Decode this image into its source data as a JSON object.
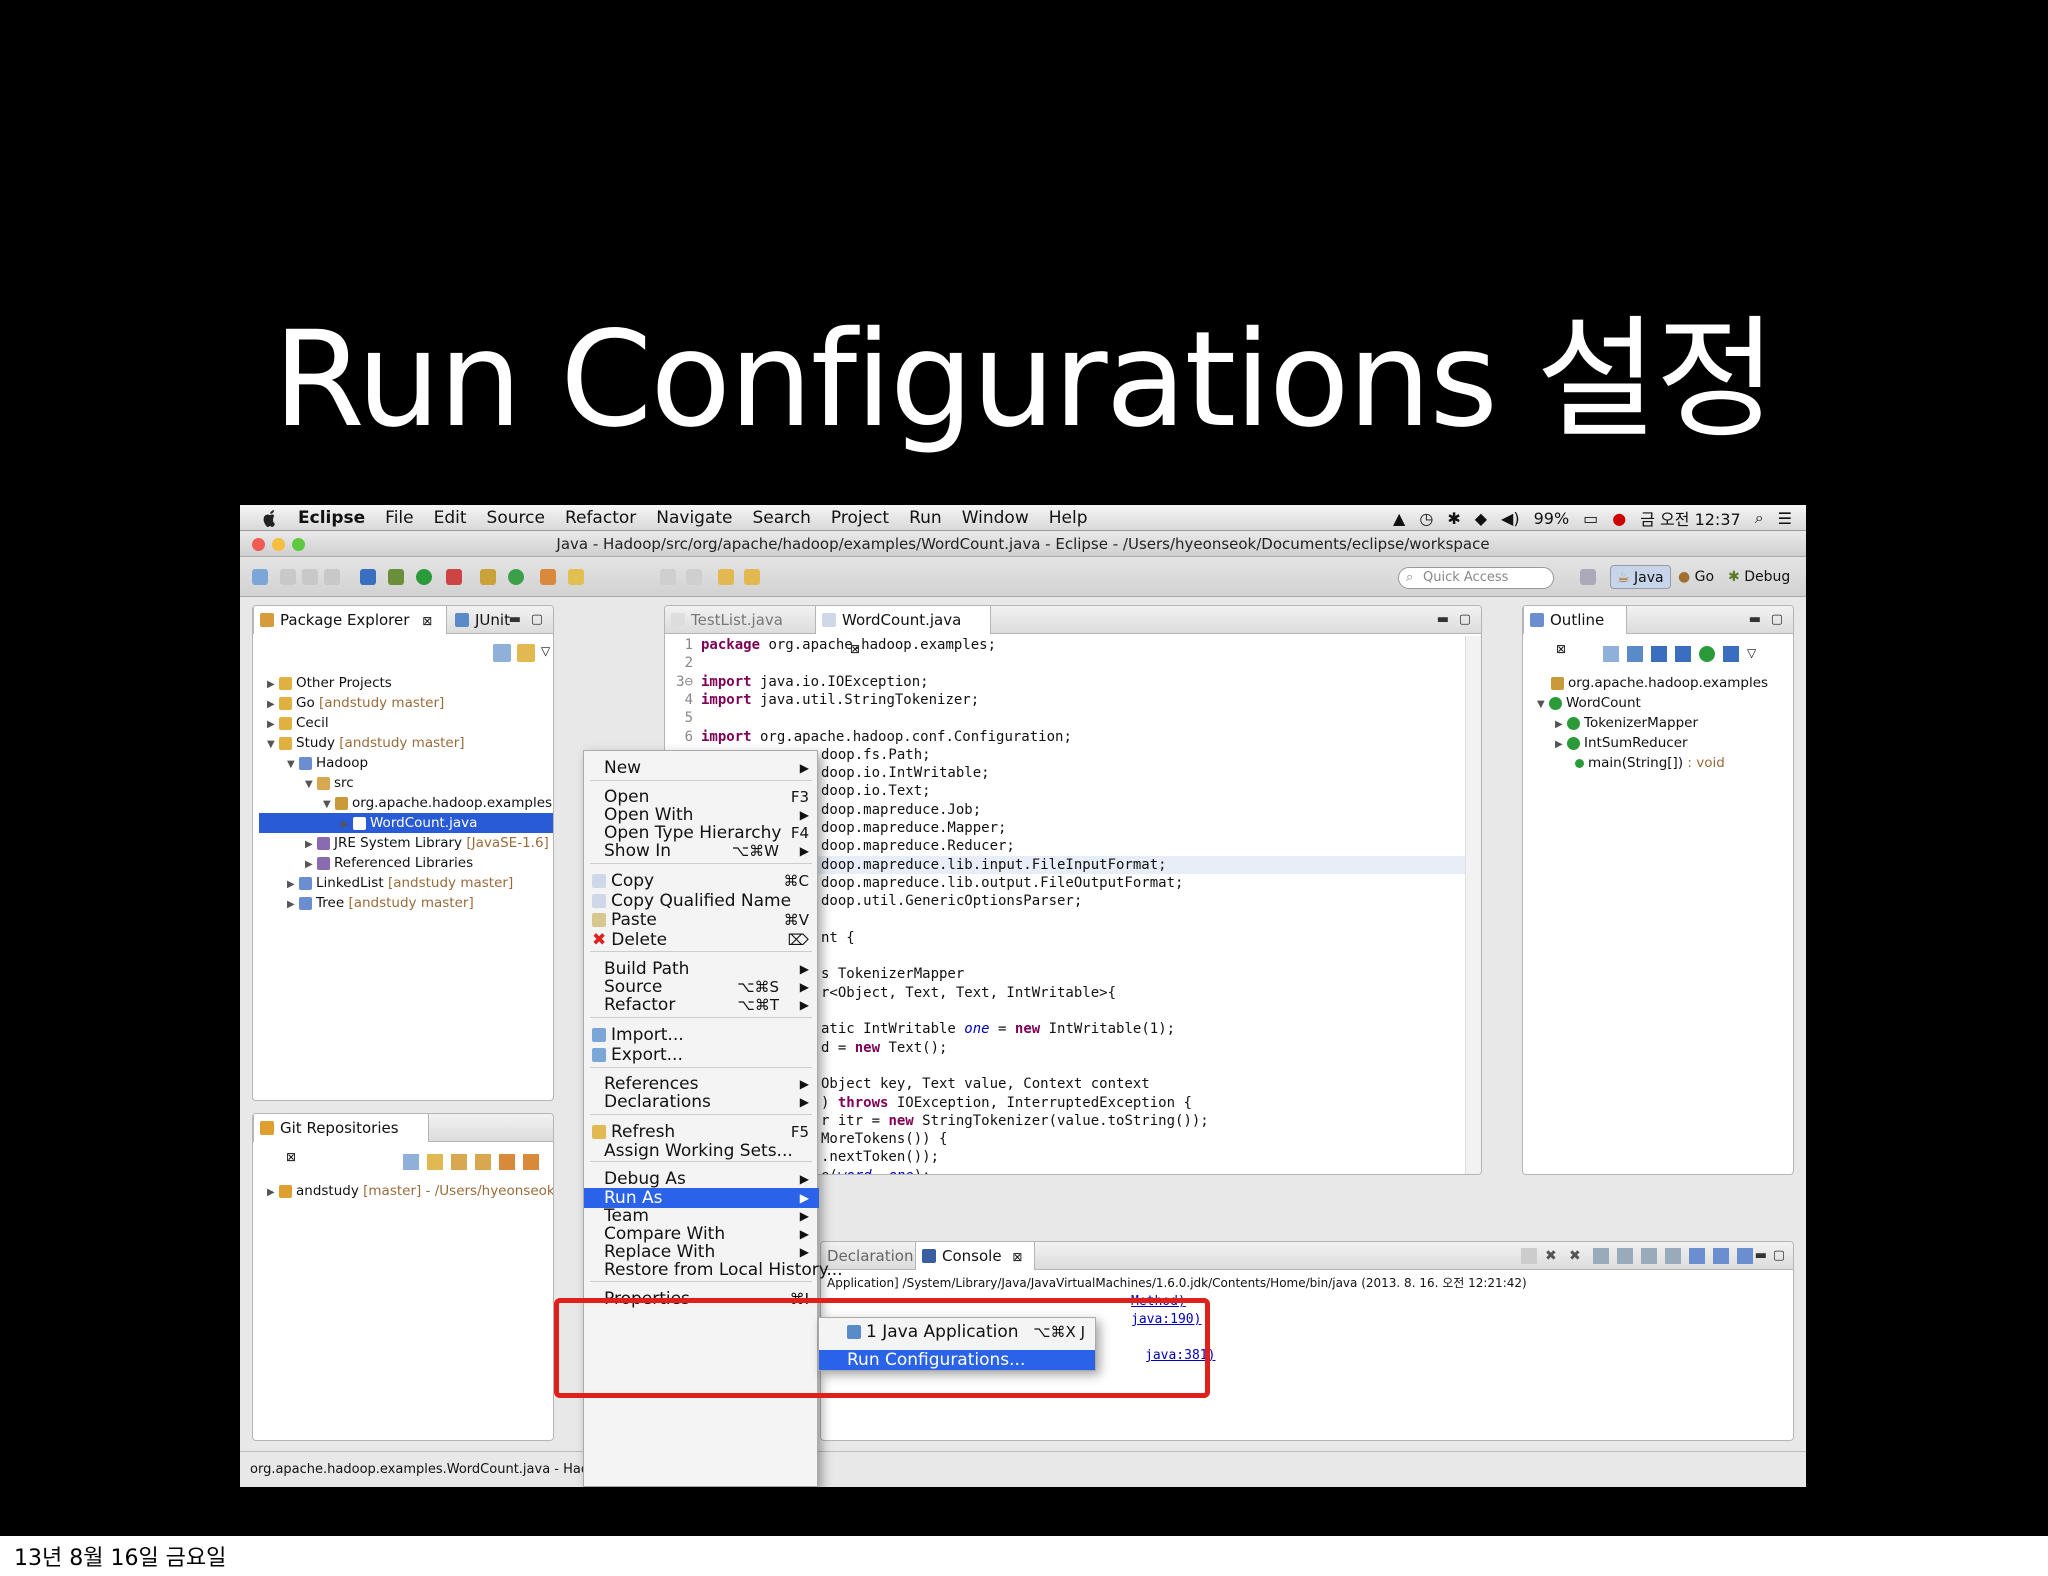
{
  "slide": {
    "title": "Run Configurations 설정",
    "footer_date": "13년 8월 16일 금요일"
  },
  "mac_menubar": {
    "app_name": "Eclipse",
    "items": [
      "File",
      "Edit",
      "Source",
      "Refactor",
      "Navigate",
      "Search",
      "Project",
      "Run",
      "Window",
      "Help"
    ],
    "battery": "99%",
    "clock": "금 오전 12:37"
  },
  "window": {
    "title": "Java - Hadoop/src/org/apache/hadoop/examples/WordCount.java - Eclipse - /Users/hyeonseok/Documents/eclipse/workspace"
  },
  "toolbar": {
    "quick_access_placeholder": "Quick Access",
    "perspectives": [
      "Java",
      "Go",
      "Debug"
    ]
  },
  "package_explorer": {
    "tabs": [
      "Package Explorer",
      "JUnit"
    ],
    "rows": [
      {
        "label": "Other Projects",
        "deco": ""
      },
      {
        "label": "Go",
        "deco": "[andstudy master]"
      },
      {
        "label": "Cecil",
        "deco": ""
      },
      {
        "label": "Study",
        "deco": "[andstudy master]"
      },
      {
        "label": "Hadoop",
        "deco": ""
      },
      {
        "label": "src",
        "deco": ""
      },
      {
        "label": "org.apache.hadoop.examples",
        "deco": ""
      },
      {
        "label": "WordCount.java",
        "deco": ""
      },
      {
        "label": "JRE System Library",
        "deco": "[JavaSE-1.6]"
      },
      {
        "label": "Referenced Libraries",
        "deco": ""
      },
      {
        "label": "LinkedList",
        "deco": "[andstudy master]"
      },
      {
        "label": "Tree",
        "deco": "[andstudy master]"
      }
    ]
  },
  "git_repositories": {
    "tab": "Git Repositories",
    "row_label": "andstudy",
    "row_deco": "[master] - /Users/hyeonseok/git"
  },
  "editor": {
    "tabs": [
      "TestList.java",
      "WordCount.java"
    ],
    "lines": [
      {
        "n": "1",
        "kw": "package",
        "rest": " org.apache.hadoop.examples;"
      },
      {
        "n": "2",
        "kw": "",
        "rest": ""
      },
      {
        "n": "3⊖",
        "kw": "import",
        "rest": " java.io.IOException;"
      },
      {
        "n": "4",
        "kw": "import",
        "rest": " java.util.StringTokenizer;"
      },
      {
        "n": "5",
        "kw": "",
        "rest": ""
      },
      {
        "n": "6",
        "kw": "import",
        "rest": " org.apache.hadoop.conf.Configuration;"
      }
    ],
    "right_lines": [
      "doop.fs.Path;",
      "doop.io.IntWritable;",
      "doop.io.Text;",
      "doop.mapreduce.Job;",
      "doop.mapreduce.Mapper;",
      "doop.mapreduce.Reducer;",
      "doop.mapreduce.lib.input.FileInputFormat;",
      "doop.mapreduce.lib.output.FileOutputFormat;",
      "doop.util.GenericOptionsParser;",
      "",
      "nt {",
      "",
      "s TokenizerMapper",
      "r<Object, Text, Text, IntWritable>{",
      "",
      "atic IntWritable one = new IntWritable(1);",
      "d = new Text();",
      "",
      "Object key, Text value, Context context",
      ") throws IOException, InterruptedException {",
      "r itr = new StringTokenizer(value.toString());",
      "MoreTokens()) {",
      ".nextToken());",
      "e(word, one);"
    ]
  },
  "outline": {
    "tab": "Outline",
    "rows": [
      {
        "label": "org.apache.hadoop.examples",
        "type": ""
      },
      {
        "label": "WordCount",
        "type": ""
      },
      {
        "label": "TokenizerMapper",
        "type": ""
      },
      {
        "label": "IntSumReducer",
        "type": ""
      },
      {
        "label": "main(String[])",
        "type": " : void"
      }
    ]
  },
  "console": {
    "tabs": [
      "Declaration",
      "Console"
    ],
    "header": "Application] /System/Library/Java/JavaVirtualMachines/1.6.0.jdk/Contents/Home/bin/java (2013. 8. 16. 오전 12:21:42)",
    "links": [
      "Method)",
      "java:190)",
      "java:381)"
    ]
  },
  "context_menu": {
    "items": [
      {
        "label": "New",
        "shortcut": "",
        "arrow": true
      },
      {
        "label": "Open",
        "shortcut": "F3",
        "arrow": false
      },
      {
        "label": "Open With",
        "shortcut": "",
        "arrow": true
      },
      {
        "label": "Open Type Hierarchy",
        "shortcut": "F4",
        "arrow": false
      },
      {
        "label": "Show In",
        "shortcut": "⌥⌘W",
        "arrow": true
      },
      {
        "label": "Copy",
        "shortcut": "⌘C",
        "arrow": false
      },
      {
        "label": "Copy Qualified Name",
        "shortcut": "",
        "arrow": false
      },
      {
        "label": "Paste",
        "shortcut": "⌘V",
        "arrow": false
      },
      {
        "label": "Delete",
        "shortcut": "⌦",
        "arrow": false
      },
      {
        "label": "Build Path",
        "shortcut": "",
        "arrow": true
      },
      {
        "label": "Source",
        "shortcut": "⌥⌘S",
        "arrow": true
      },
      {
        "label": "Refactor",
        "shortcut": "⌥⌘T",
        "arrow": true
      },
      {
        "label": "Import...",
        "shortcut": "",
        "arrow": false
      },
      {
        "label": "Export...",
        "shortcut": "",
        "arrow": false
      },
      {
        "label": "References",
        "shortcut": "",
        "arrow": true
      },
      {
        "label": "Declarations",
        "shortcut": "",
        "arrow": true
      },
      {
        "label": "Refresh",
        "shortcut": "F5",
        "arrow": false
      },
      {
        "label": "Assign Working Sets...",
        "shortcut": "",
        "arrow": false
      },
      {
        "label": "Debug As",
        "shortcut": "",
        "arrow": true
      },
      {
        "label": "Run As",
        "shortcut": "",
        "arrow": true
      },
      {
        "label": "Team",
        "shortcut": "",
        "arrow": true
      },
      {
        "label": "Compare With",
        "shortcut": "",
        "arrow": true
      },
      {
        "label": "Replace With",
        "shortcut": "",
        "arrow": true
      },
      {
        "label": "Restore from Local History...",
        "shortcut": "",
        "arrow": false
      },
      {
        "label": "Properties",
        "shortcut": "⌘I",
        "arrow": false
      }
    ]
  },
  "submenu": {
    "item1": "1 Java Application",
    "item1_shortcut": "⌥⌘X J",
    "item2": "Run Configurations..."
  },
  "statusbar": {
    "text": "org.apache.hadoop.examples.WordCount.java - Hadoop"
  },
  "colors": {
    "selection": "#2a5bd7",
    "menu_highlight": "#2a63e8",
    "annotation_red": "#e0201b"
  }
}
